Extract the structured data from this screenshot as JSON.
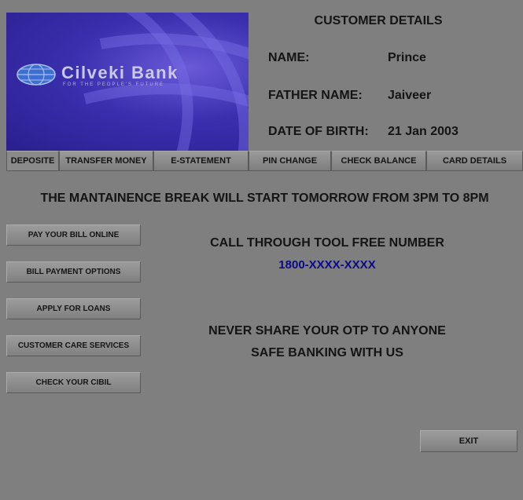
{
  "banner": {
    "bank_name": "Cilveki Bank",
    "tagline": "FOR THE PEOPLE'S FUTURE",
    "logo_icon": "globe-icon"
  },
  "customer": {
    "heading": "CUSTOMER DETAILS",
    "name_label": "NAME:",
    "name_value": "Prince",
    "father_label": "FATHER NAME:",
    "father_value": "Jaiveer",
    "dob_label": "DATE OF BIRTH:",
    "dob_value": "21 Jan 2003"
  },
  "nav": {
    "tabs": [
      {
        "label": "DEPOSITE"
      },
      {
        "label": "TRANSFER MONEY"
      },
      {
        "label": "E-STATEMENT"
      },
      {
        "label": "PIN CHANGE"
      },
      {
        "label": "CHECK BALANCE"
      },
      {
        "label": "CARD DETAILS"
      }
    ]
  },
  "notice": "THE MANTAINENCE BREAK WILL START TOMORROW FROM 3PM TO 8PM",
  "side_buttons": [
    {
      "label": "PAY YOUR BILL ONLINE"
    },
    {
      "label": "BILL PAYMENT OPTIONS"
    },
    {
      "label": "APPLY FOR LOANS"
    },
    {
      "label": "CUSTOMER CARE SERVICES"
    },
    {
      "label": "CHECK YOUR CIBIL"
    }
  ],
  "info": {
    "call_text": "CALL THROUGH TOOL FREE NUMBER",
    "phone": "1800-XXXX-XXXX",
    "otp_warning": "NEVER SHARE YOUR OTP TO ANYONE",
    "safe_text": "SAFE BANKING WITH US"
  },
  "exit_label": "EXIT",
  "colors": {
    "background": "#7f7f7f",
    "banner_blue": "#3a2fae",
    "phone_blue": "#0a0a8c"
  }
}
